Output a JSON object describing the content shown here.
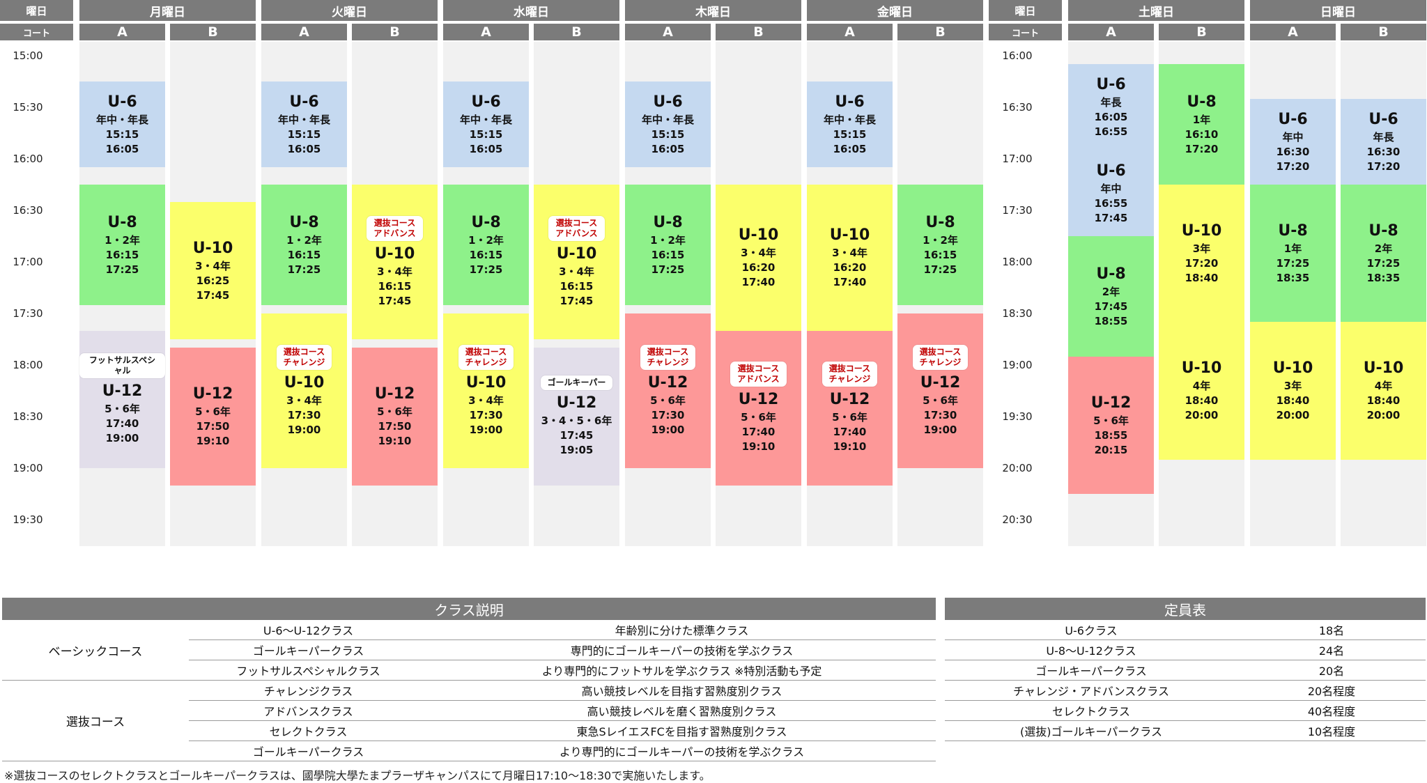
{
  "weekday_header": {
    "day_label": "曜日",
    "court_label": "コート"
  },
  "weekend_header": {
    "day_label": "曜日",
    "court_label": "コート"
  },
  "weekday_times": [
    "15:00",
    "15:30",
    "16:00",
    "16:30",
    "17:00",
    "17:30",
    "18:00",
    "18:30",
    "19:00",
    "19:30"
  ],
  "weekend_times": [
    "16:00",
    "16:30",
    "17:00",
    "17:30",
    "18:00",
    "18:30",
    "19:00",
    "19:30",
    "20:00",
    "20:30"
  ],
  "days": [
    {
      "name": "月曜日",
      "group": "weekday",
      "courts": [
        {
          "name": "A",
          "blocks": [
            {
              "color": "blue",
              "start": "15:15",
              "end": "16:05",
              "lines": [
                "U-6",
                "年中・年長",
                "15:15",
                "16:05"
              ]
            },
            {
              "color": "green",
              "start": "16:15",
              "end": "17:25",
              "lines": [
                "U-8",
                "1・2年",
                "16:15",
                "17:25"
              ]
            },
            {
              "color": "lav",
              "start": "17:40",
              "end": "19:00",
              "tag": "フットサルスペシャル",
              "tag_color": "black",
              "lines": [
                "U-12",
                "5・6年",
                "17:40",
                "19:00"
              ]
            }
          ]
        },
        {
          "name": "B",
          "blocks": [
            {
              "color": "yellow",
              "start": "16:25",
              "end": "17:45",
              "lines": [
                "U-10",
                "3・4年",
                "16:25",
                "17:45"
              ]
            },
            {
              "color": "red",
              "start": "17:50",
              "end": "19:10",
              "lines": [
                "U-12",
                "5・6年",
                "17:50",
                "19:10"
              ]
            }
          ]
        }
      ]
    },
    {
      "name": "火曜日",
      "group": "weekday",
      "courts": [
        {
          "name": "A",
          "blocks": [
            {
              "color": "blue",
              "start": "15:15",
              "end": "16:05",
              "lines": [
                "U-6",
                "年中・年長",
                "15:15",
                "16:05"
              ]
            },
            {
              "color": "green",
              "start": "16:15",
              "end": "17:25",
              "lines": [
                "U-8",
                "1・2年",
                "16:15",
                "17:25"
              ]
            },
            {
              "color": "yellow",
              "start": "17:30",
              "end": "19:00",
              "tag": "選抜コース\nチャレンジ",
              "tag_color": "red",
              "lines": [
                "U-10",
                "3・4年",
                "17:30",
                "19:00"
              ]
            }
          ]
        },
        {
          "name": "B",
          "blocks": [
            {
              "color": "yellow",
              "start": "16:15",
              "end": "17:45",
              "tag": "選抜コース\nアドバンス",
              "tag_color": "red",
              "lines": [
                "U-10",
                "3・4年",
                "16:15",
                "17:45"
              ]
            },
            {
              "color": "red",
              "start": "17:50",
              "end": "19:10",
              "lines": [
                "U-12",
                "5・6年",
                "17:50",
                "19:10"
              ]
            }
          ]
        }
      ]
    },
    {
      "name": "水曜日",
      "group": "weekday",
      "courts": [
        {
          "name": "A",
          "blocks": [
            {
              "color": "blue",
              "start": "15:15",
              "end": "16:05",
              "lines": [
                "U-6",
                "年中・年長",
                "15:15",
                "16:05"
              ]
            },
            {
              "color": "green",
              "start": "16:15",
              "end": "17:25",
              "lines": [
                "U-8",
                "1・2年",
                "16:15",
                "17:25"
              ]
            },
            {
              "color": "yellow",
              "start": "17:30",
              "end": "19:00",
              "tag": "選抜コース\nチャレンジ",
              "tag_color": "red",
              "lines": [
                "U-10",
                "3・4年",
                "17:30",
                "19:00"
              ]
            }
          ]
        },
        {
          "name": "B",
          "blocks": [
            {
              "color": "yellow",
              "start": "16:15",
              "end": "17:45",
              "tag": "選抜コース\nアドバンス",
              "tag_color": "red",
              "lines": [
                "U-10",
                "3・4年",
                "16:15",
                "17:45"
              ]
            },
            {
              "color": "lav",
              "start": "17:50",
              "end": "19:10",
              "tag": "ゴールキーパー",
              "tag_color": "black",
              "lines": [
                "U-12",
                "3・4・5・6年",
                "17:45",
                "19:05"
              ]
            }
          ]
        }
      ]
    },
    {
      "name": "木曜日",
      "group": "weekday",
      "courts": [
        {
          "name": "A",
          "blocks": [
            {
              "color": "blue",
              "start": "15:15",
              "end": "16:05",
              "lines": [
                "U-6",
                "年中・年長",
                "15:15",
                "16:05"
              ]
            },
            {
              "color": "green",
              "start": "16:15",
              "end": "17:25",
              "lines": [
                "U-8",
                "1・2年",
                "16:15",
                "17:25"
              ]
            },
            {
              "color": "red",
              "start": "17:30",
              "end": "19:00",
              "tag": "選抜コース\nチャレンジ",
              "tag_color": "red",
              "lines": [
                "U-12",
                "5・6年",
                "17:30",
                "19:00"
              ]
            }
          ]
        },
        {
          "name": "B",
          "blocks": [
            {
              "color": "yellow",
              "start": "16:15",
              "end": "17:40",
              "lines": [
                "U-10",
                "3・4年",
                "16:20",
                "17:40"
              ]
            },
            {
              "color": "red",
              "start": "17:40",
              "end": "19:10",
              "tag": "選抜コース\nアドバンス",
              "tag_color": "red",
              "lines": [
                "U-12",
                "5・6年",
                "17:40",
                "19:10"
              ]
            }
          ]
        }
      ]
    },
    {
      "name": "金曜日",
      "group": "weekday",
      "courts": [
        {
          "name": "A",
          "blocks": [
            {
              "color": "blue",
              "start": "15:15",
              "end": "16:05",
              "lines": [
                "U-6",
                "年中・年長",
                "15:15",
                "16:05"
              ]
            },
            {
              "color": "yellow",
              "start": "16:15",
              "end": "17:40",
              "lines": [
                "U-10",
                "3・4年",
                "16:20",
                "17:40"
              ]
            },
            {
              "color": "red",
              "start": "17:40",
              "end": "19:10",
              "tag": "選抜コース\nチャレンジ",
              "tag_color": "red",
              "lines": [
                "U-12",
                "5・6年",
                "17:40",
                "19:10"
              ]
            }
          ]
        },
        {
          "name": "B",
          "blocks": [
            {
              "color": "green",
              "start": "16:15",
              "end": "17:25",
              "lines": [
                "U-8",
                "1・2年",
                "16:15",
                "17:25"
              ]
            },
            {
              "color": "red",
              "start": "17:30",
              "end": "19:00",
              "tag": "選抜コース\nチャレンジ",
              "tag_color": "red",
              "lines": [
                "U-12",
                "5・6年",
                "17:30",
                "19:00"
              ]
            }
          ]
        }
      ]
    },
    {
      "name": "土曜日",
      "group": "weekend",
      "courts": [
        {
          "name": "A",
          "blocks": [
            {
              "color": "blue",
              "start": "16:05",
              "end": "16:55",
              "lines": [
                "U-6",
                "年長",
                "16:05",
                "16:55"
              ]
            },
            {
              "color": "blue",
              "start": "16:55",
              "end": "17:45",
              "lines": [
                "U-6",
                "年中",
                "16:55",
                "17:45"
              ]
            },
            {
              "color": "green",
              "start": "17:45",
              "end": "18:55",
              "lines": [
                "U-8",
                "2年",
                "17:45",
                "18:55"
              ]
            },
            {
              "color": "red",
              "start": "18:55",
              "end": "20:15",
              "lines": [
                "U-12",
                "5・6年",
                "18:55",
                "20:15"
              ]
            }
          ]
        },
        {
          "name": "B",
          "blocks": [
            {
              "color": "green",
              "start": "16:05",
              "end": "17:15",
              "lines": [
                "U-8",
                "1年",
                "16:10",
                "17:20"
              ]
            },
            {
              "color": "yellow",
              "start": "17:15",
              "end": "18:35",
              "lines": [
                "U-10",
                "3年",
                "17:20",
                "18:40"
              ]
            },
            {
              "color": "yellow",
              "start": "18:35",
              "end": "19:55",
              "lines": [
                "U-10",
                "4年",
                "18:40",
                "20:00"
              ]
            }
          ]
        }
      ]
    },
    {
      "name": "日曜日",
      "group": "weekend",
      "courts": [
        {
          "name": "A",
          "blocks": [
            {
              "color": "blue",
              "start": "16:25",
              "end": "17:15",
              "lines": [
                "U-6",
                "年中",
                "16:30",
                "17:20"
              ]
            },
            {
              "color": "green",
              "start": "17:15",
              "end": "18:35",
              "lines": [
                "U-8",
                "1年",
                "17:25",
                "18:35"
              ]
            },
            {
              "color": "yellow",
              "start": "18:35",
              "end": "19:55",
              "lines": [
                "U-10",
                "3年",
                "18:40",
                "20:00"
              ]
            }
          ]
        },
        {
          "name": "B",
          "blocks": [
            {
              "color": "blue",
              "start": "16:25",
              "end": "17:15",
              "lines": [
                "U-6",
                "年長",
                "16:30",
                "17:20"
              ]
            },
            {
              "color": "green",
              "start": "17:15",
              "end": "18:35",
              "lines": [
                "U-8",
                "2年",
                "17:25",
                "18:35"
              ]
            },
            {
              "color": "yellow",
              "start": "18:35",
              "end": "19:55",
              "lines": [
                "U-10",
                "4年",
                "18:40",
                "20:00"
              ]
            }
          ]
        }
      ]
    }
  ],
  "class_table": {
    "title": "クラス説明",
    "groups": [
      {
        "name": "ベーシックコース",
        "rows": [
          {
            "class": "U-6～U-12クラス",
            "desc": "年齢別に分けた標準クラス"
          },
          {
            "class": "ゴールキーパークラス",
            "desc": "専門的にゴールキーパーの技術を学ぶクラス"
          },
          {
            "class": "フットサルスペシャルクラス",
            "desc": "より専門的にフットサルを学ぶクラス ※特別活動も予定"
          }
        ]
      },
      {
        "name": "選抜コース",
        "rows": [
          {
            "class": "チャレンジクラス",
            "desc": "高い競技レベルを目指す習熟度別クラス"
          },
          {
            "class": "アドバンスクラス",
            "desc": "高い競技レベルを磨く習熟度別クラス"
          },
          {
            "class": "セレクトクラス",
            "desc": "東急SレイエスFCを目指す習熟度別クラス"
          },
          {
            "class": "ゴールキーパークラス",
            "desc": "より専門的にゴールキーパーの技術を学ぶクラス"
          }
        ]
      }
    ]
  },
  "capacity_table": {
    "title": "定員表",
    "rows": [
      {
        "class": "U-6クラス",
        "cap": "18名"
      },
      {
        "class": "U-8～U-12クラス",
        "cap": "24名"
      },
      {
        "class": "ゴールキーパークラス",
        "cap": "20名"
      },
      {
        "class": "チャレンジ・アドバンスクラス",
        "cap": "20名程度"
      },
      {
        "class": "セレクトクラス",
        "cap": "40名程度"
      },
      {
        "class": "(選抜)ゴールキーパークラス",
        "cap": "10名程度"
      }
    ]
  },
  "footnote": "※選抜コースのセレクトクラスとゴールキーパークラスは、國學院大學たまプラーザキャンパスにて月曜日17:10～18:30で実施いたします。",
  "colors": {
    "blue": "#c5d9f0",
    "green": "#8ef18a",
    "yellow": "#fbff6b",
    "red": "#fd9898",
    "lav": "#e2deea",
    "header": "#7b7b7b"
  }
}
